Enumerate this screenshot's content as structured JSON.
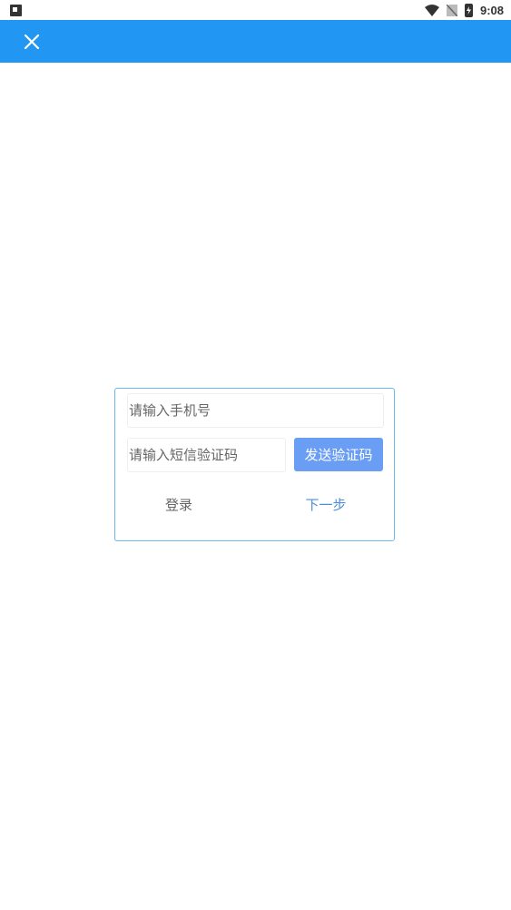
{
  "status_bar": {
    "time": "9:08",
    "icons": [
      "notification-a-icon",
      "wifi-icon",
      "no-sim-icon",
      "battery-charging-icon"
    ]
  },
  "app_bar": {
    "color": "#2196f3",
    "close_icon": "close-icon"
  },
  "login_form": {
    "phone_placeholder": "请输入手机号",
    "phone_value": "",
    "code_placeholder": "请输入短信验证码",
    "code_value": "",
    "send_code_label": "发送验证码",
    "login_label": "登录",
    "next_label": "下一步"
  },
  "colors": {
    "primary": "#2196f3",
    "button": "#6a9ef4",
    "link": "#4a8fe0",
    "card_border": "#6cbaf0"
  }
}
